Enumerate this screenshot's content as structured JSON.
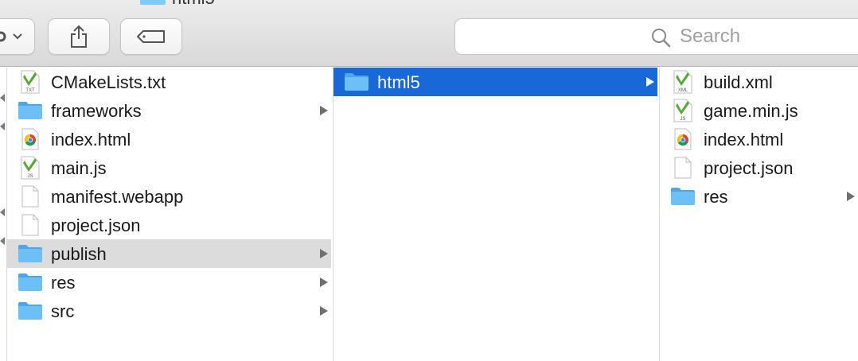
{
  "toolbar": {
    "title_crumb": "html5",
    "search_placeholder": "Search"
  },
  "columns": [
    {
      "items": [
        {
          "label": "CMakeLists.txt",
          "icon": "txt-file-icon",
          "kind": "file"
        },
        {
          "label": "frameworks",
          "icon": "folder-icon",
          "kind": "folder"
        },
        {
          "label": "index.html",
          "icon": "chrome-html-icon",
          "kind": "file"
        },
        {
          "label": "main.js",
          "icon": "js-file-icon",
          "kind": "file"
        },
        {
          "label": "manifest.webapp",
          "icon": "blank-file-icon",
          "kind": "file"
        },
        {
          "label": "project.json",
          "icon": "blank-file-icon",
          "kind": "file"
        },
        {
          "label": "publish",
          "icon": "folder-icon",
          "kind": "folder",
          "state": "selected-inactive"
        },
        {
          "label": "res",
          "icon": "folder-icon",
          "kind": "folder"
        },
        {
          "label": "src",
          "icon": "folder-icon",
          "kind": "folder"
        }
      ]
    },
    {
      "items": [
        {
          "label": "html5",
          "icon": "folder-icon",
          "kind": "folder",
          "state": "selected-active"
        }
      ]
    },
    {
      "items": [
        {
          "label": "build.xml",
          "icon": "xml-file-icon",
          "kind": "file"
        },
        {
          "label": "game.min.js",
          "icon": "js-file-icon",
          "kind": "file"
        },
        {
          "label": "index.html",
          "icon": "chrome-html-icon",
          "kind": "file"
        },
        {
          "label": "project.json",
          "icon": "blank-file-icon",
          "kind": "file"
        },
        {
          "label": "res",
          "icon": "folder-icon",
          "kind": "folder"
        }
      ]
    }
  ],
  "colors": {
    "selection_active": "#1669d6",
    "selection_inactive": "#dcdcdc",
    "folder_blue": "#6cc0f5"
  }
}
